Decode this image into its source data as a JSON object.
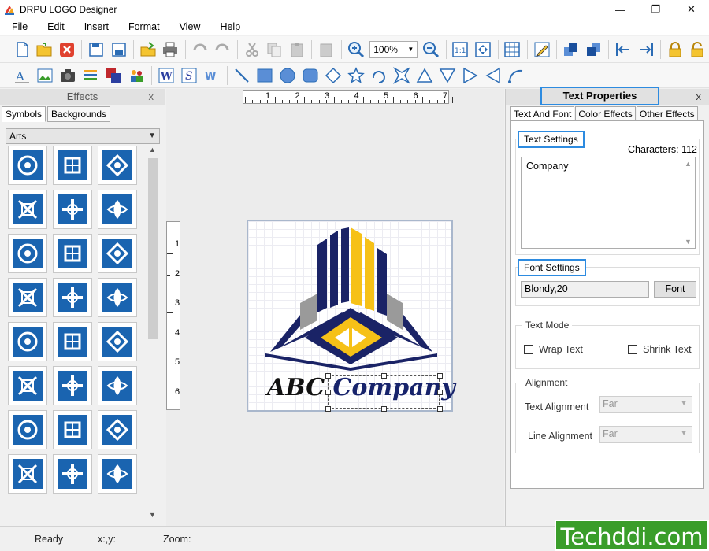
{
  "window": {
    "title": "DRPU LOGO Designer"
  },
  "menu": [
    "File",
    "Edit",
    "Insert",
    "Format",
    "View",
    "Help"
  ],
  "toolbar": {
    "zoom_value": "100%"
  },
  "effects": {
    "title": "Effects",
    "close": "x",
    "tabs": [
      "Symbols",
      "Backgrounds"
    ],
    "category": "Arts"
  },
  "ruler": {
    "h_numbers": [
      "1",
      "2",
      "3",
      "4",
      "5",
      "6",
      "7"
    ],
    "v_numbers": [
      "1",
      "2",
      "3",
      "4",
      "5",
      "6"
    ]
  },
  "logo": {
    "text_part1": "ABC",
    "text_part2": "Company",
    "colors": {
      "navy": "#1a2366",
      "yellow": "#f6c117",
      "gray": "#9a9a9a"
    }
  },
  "props": {
    "title": "Text Properties",
    "close": "x",
    "tabs": [
      "Text And Font",
      "Color Effects",
      "Other Effects"
    ],
    "text_settings_label": "Text Settings",
    "characters": "Characters: 112",
    "text_value": "Company",
    "font_settings_label": "Font Settings",
    "font_value": "Blondy,20",
    "font_button": "Font",
    "text_mode_label": "Text Mode",
    "wrap_text": "Wrap Text",
    "shrink_text": "Shrink Text",
    "alignment_label": "Alignment",
    "text_alignment_label": "Text Alignment",
    "text_alignment_value": "Far",
    "line_alignment_label": "Line Alignment",
    "line_alignment_value": "Far"
  },
  "status": {
    "ready": "Ready",
    "xy": "x:,y:",
    "zoom": "Zoom:"
  },
  "watermark": "Techddi.com",
  "colors": {
    "accent_highlight": "#2d8be0",
    "symbol_blue": "#1a64b0"
  }
}
